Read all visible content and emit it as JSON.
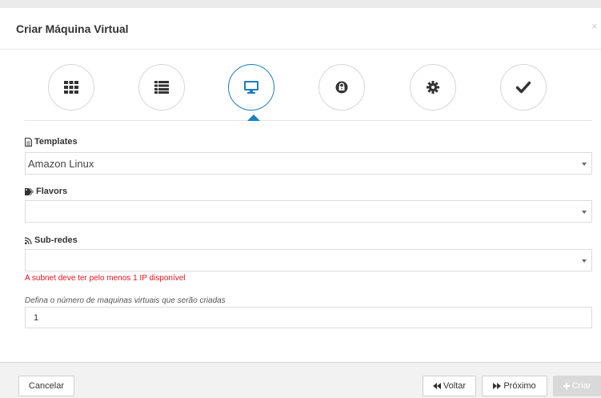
{
  "dialog": {
    "title": "Criar Máquina Virtual",
    "close_label": "×"
  },
  "steps": [
    {
      "icon": "grid-icon",
      "active": false
    },
    {
      "icon": "list-icon",
      "active": false
    },
    {
      "icon": "monitor-icon",
      "active": true
    },
    {
      "icon": "lock-icon",
      "active": false
    },
    {
      "icon": "gear-icon",
      "active": false
    },
    {
      "icon": "checkmark-icon",
      "active": false
    }
  ],
  "form": {
    "templates": {
      "label": "Templates",
      "value": "Amazon Linux",
      "icon": "file-icon"
    },
    "flavors": {
      "label": "Flavors",
      "value": "",
      "icon": "tags-icon"
    },
    "subnets": {
      "label": "Sub-redes",
      "value": "",
      "icon": "rss-icon",
      "error": "A subnet deve ter pelo menos 1 IP disponível"
    },
    "vm_count": {
      "hint": "Defina o número de maquinas virtuais que serão criadas",
      "value": "1"
    }
  },
  "footer": {
    "cancel_label": "Cancelar",
    "back_label": "Voltar",
    "next_label": "Próximo",
    "create_label": "Criar"
  },
  "colors": {
    "accent": "#1a7fbf",
    "error": "#e8121e",
    "disabled": "#d9d9d9"
  }
}
